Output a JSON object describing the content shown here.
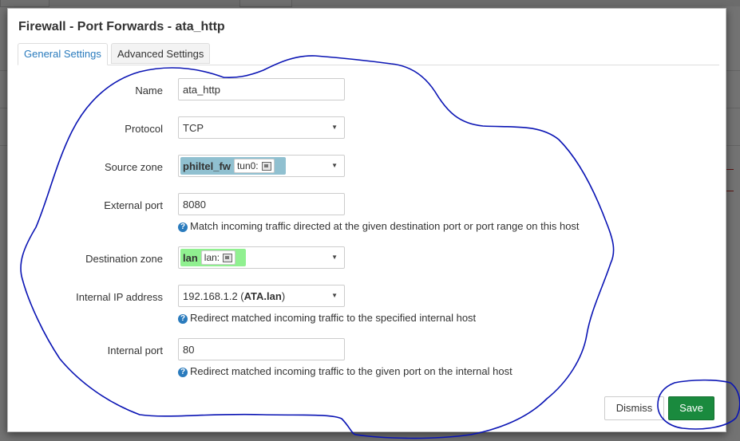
{
  "modal": {
    "title": "Firewall - Port Forwards - ata_http",
    "tabs": [
      {
        "label": "General Settings",
        "active": true
      },
      {
        "label": "Advanced Settings",
        "active": false
      }
    ]
  },
  "form": {
    "name": {
      "label": "Name",
      "value": "ata_http"
    },
    "protocol": {
      "label": "Protocol",
      "value": "TCP"
    },
    "source_zone": {
      "label": "Source zone",
      "zone": "philtel_fw",
      "device": "tun0:",
      "color": "#90c0d0"
    },
    "external_port": {
      "label": "External port",
      "value": "8080",
      "help": "Match incoming traffic directed at the given destination port or port range on this host"
    },
    "destination_zone": {
      "label": "Destination zone",
      "zone": "lan",
      "device": "lan:",
      "color": "#90f090"
    },
    "internal_ip": {
      "label": "Internal IP address",
      "value_prefix": "192.168.1.2 (",
      "value_host": "ATA.lan",
      "value_suffix": ")",
      "help": "Redirect matched incoming traffic to the specified internal host"
    },
    "internal_port": {
      "label": "Internal port",
      "value": "80",
      "help": "Redirect matched incoming traffic to the given port on the internal host"
    }
  },
  "buttons": {
    "dismiss": "Dismiss",
    "save": "Save"
  },
  "colors": {
    "save": "#1a8a3e",
    "active_tab": "#2a7bbd",
    "annotation_ink": "#0a14b4"
  }
}
